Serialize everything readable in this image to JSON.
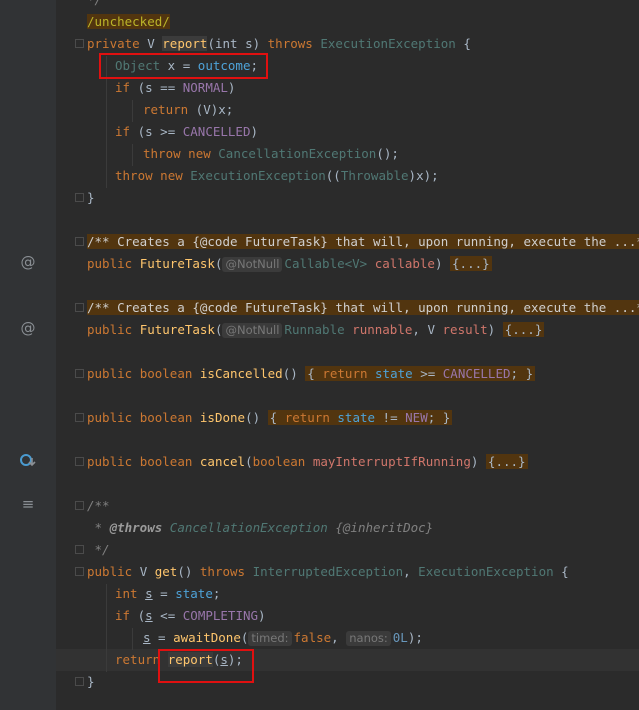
{
  "code": {
    "l0": "*/",
    "l1": "/unchecked/",
    "l2_kw1": "private",
    "l2_type": "V",
    "l2_fn": "report",
    "l2_rest": "(int s) ",
    "l2_kw2": "throws",
    "l2_exc": "ExecutionException",
    "l2_end": " {",
    "l3_type": "Object",
    "l3_mid": " x = ",
    "l3_fld": "outcome",
    "l3_end": ";",
    "l4_kw": "if",
    "l4_a": " (s == ",
    "l4_fld": "NORMAL",
    "l4_b": ")",
    "l5_kw": "return",
    "l5_rest": " (V)x;",
    "l6_kw": "if",
    "l6_a": " (s >= ",
    "l6_fld": "CANCELLED",
    "l6_b": ")",
    "l7_kw1": "throw",
    "l7_kw2": "new",
    "l7_cls": "CancellationException",
    "l7_end": "();",
    "l8_kw1": "throw",
    "l8_kw2": "new",
    "l8_cls": "ExecutionException",
    "l8_a": "((",
    "l8_cls2": "Throwable",
    "l8_b": ")x);",
    "l9": "}",
    "doc1": "/** Creates a {@code FutureTask} that will, upon running, execute the ...*/",
    "c1_kw": "public",
    "c1_fn": "FutureTask",
    "c1_hint": "@NotNull",
    "c1_type": "Callable<V>",
    "c1_param": "callable",
    "c1_body": "{...}",
    "doc2": "/** Creates a {@code FutureTask} that will, upon running, execute the ...*/",
    "c2_kw": "public",
    "c2_fn": "FutureTask",
    "c2_hint": "@NotNull",
    "c2_type": "Runnable",
    "c2_param": "runnable",
    "c2_v": "V",
    "c2_param2": "result",
    "c2_body": "{...}",
    "m1_kw1": "public",
    "m1_kw2": "boolean",
    "m1_fn": "isCancelled",
    "m1_kw3": "return",
    "m1_fld": "state",
    "m1_op": " >= ",
    "m1_fld2": "CANCELLED",
    "m2_kw1": "public",
    "m2_kw2": "boolean",
    "m2_fn": "isDone",
    "m2_kw3": "return",
    "m2_fld": "state",
    "m2_op": " != ",
    "m2_fld2": "NEW",
    "m3_kw1": "public",
    "m3_kw2": "boolean",
    "m3_fn": "cancel",
    "m3_kw3": "boolean",
    "m3_param": "mayInterruptIfRunning",
    "m3_body": "{...}",
    "jd1": "/**",
    "jd2_a": " * ",
    "jd2_tag": "@throws",
    "jd2_cls": "CancellationException",
    "jd2_b": " {@inheritDoc}",
    "jd3": " */",
    "g_kw1": "public",
    "g_type": "V",
    "g_fn": "get",
    "g_kw2": "throws",
    "g_exc1": "InterruptedException",
    "g_exc2": "ExecutionException",
    "g1_kw": "int",
    "g1_var": "s",
    "g1_fld": "state",
    "g2_kw": "if",
    "g2_var": "s",
    "g2_fld": "COMPLETING",
    "g3_var": "s",
    "g3_fn": "awaitDone",
    "g3_hint1": "timed:",
    "g3_kw": "false",
    "g3_hint2": "nanos:",
    "g3_num": "0L",
    "g4_kw": "return",
    "g4_fn": "report",
    "g4_var": "s",
    "g5": "}"
  },
  "gutter": {
    "icon_override1": "@",
    "icon_override2": "@",
    "icon_overriding": "o-arrow-icon",
    "icon_doc": "≡"
  }
}
